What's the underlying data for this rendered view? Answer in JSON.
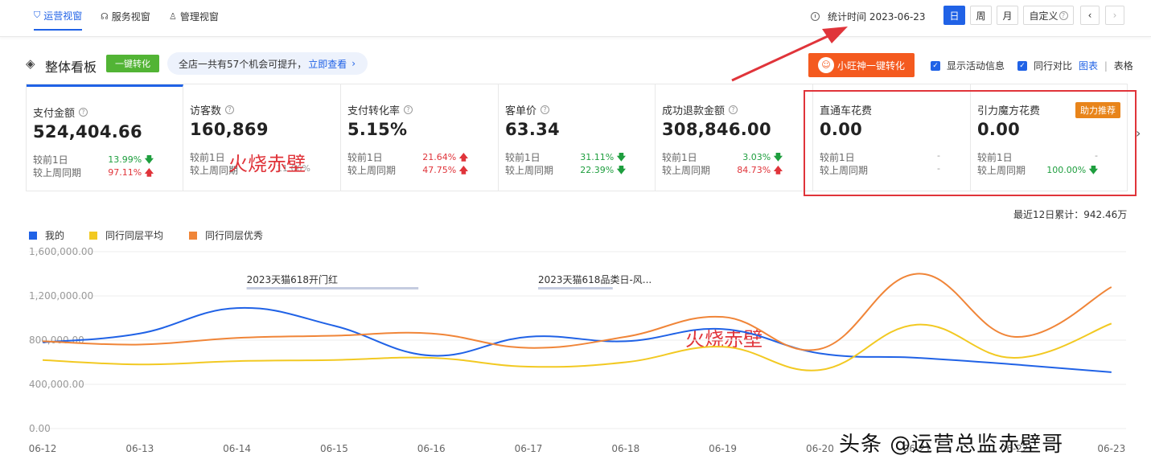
{
  "nav": {
    "tabs": [
      {
        "label": "运营视窗",
        "icon": "shield-icon",
        "active": true
      },
      {
        "label": "服务视窗",
        "icon": "headset-icon",
        "active": false
      },
      {
        "label": "管理视窗",
        "icon": "medal-icon",
        "active": false
      }
    ],
    "stat_time_label": "统计时间 2023-06-23",
    "periods": [
      "日",
      "周",
      "月"
    ],
    "custom_label": "自定义",
    "prev_icon": "chevron-left-icon",
    "next_icon": "chevron-right-icon"
  },
  "board": {
    "title": "整体看板",
    "convert_btn": "一键转化",
    "banner_text": "全店一共有57个机会可提升，",
    "banner_link": "立即查看",
    "xw_btn": "小旺神一键转化",
    "show_activity": "显示活动信息",
    "peer_compare": "同行对比",
    "view_chart": "图表",
    "view_sep": "|",
    "view_table": "表格"
  },
  "cards": [
    {
      "label": "支付金额",
      "value": "524,404.66",
      "d1_label": "较前1日",
      "d1": "13.99%",
      "d1_dir": "down",
      "w_label": "较上周同期",
      "w": "97.11%",
      "w_dir": "up",
      "help": true
    },
    {
      "label": "访客数",
      "value": "160,869",
      "d1_label": "较前1日",
      "d1": "",
      "d1_dir": "",
      "w_label": "较上周同期",
      "w": "11.06%",
      "w_dir": "",
      "help": true
    },
    {
      "label": "支付转化率",
      "value": "5.15%",
      "d1_label": "较前1日",
      "d1": "21.64%",
      "d1_dir": "up",
      "w_label": "较上周同期",
      "w": "47.75%",
      "w_dir": "up",
      "help": true
    },
    {
      "label": "客单价",
      "value": "63.34",
      "d1_label": "较前1日",
      "d1": "31.11%",
      "d1_dir": "down",
      "w_label": "较上周同期",
      "w": "22.39%",
      "w_dir": "down",
      "help": true
    },
    {
      "label": "成功退款金额",
      "value": "308,846.00",
      "d1_label": "较前1日",
      "d1": "3.03%",
      "d1_dir": "down",
      "w_label": "较上周同期",
      "w": "84.73%",
      "w_dir": "up",
      "help": true
    },
    {
      "label": "直通车花费",
      "value": "0.00",
      "d1_label": "较前1日",
      "d1": "-",
      "d1_dir": "none",
      "w_label": "较上周同期",
      "w": "-",
      "w_dir": "none",
      "help": false
    },
    {
      "label": "引力魔方花费",
      "value": "0.00",
      "d1_label": "较前1日",
      "d1": "-",
      "d1_dir": "none",
      "w_label": "较上周同期",
      "w": "100.00%",
      "w_dir": "down",
      "help": false,
      "badge": "助力推荐"
    }
  ],
  "overlay_text": "火烧赤壁",
  "cum_total": "最近12日累计：942.46万",
  "footer_watermark": "头条 @运营总监赤壁哥",
  "colors": {
    "mine": "#2062e6",
    "avg": "#f2c922",
    "top": "#f08538",
    "accent": "#2062e6"
  },
  "chart_data": {
    "type": "line",
    "x": [
      "06-12",
      "06-13",
      "06-14",
      "06-15",
      "06-16",
      "06-17",
      "06-18",
      "06-19",
      "06-20",
      "06-21",
      "06-22",
      "06-23"
    ],
    "yticks": [
      "1,600,000.00",
      "1,200,000.00",
      "800,000.00",
      "400,000.00",
      "0.00"
    ],
    "ylim": [
      0,
      1600000
    ],
    "grid": true,
    "series": [
      {
        "name": "我的",
        "values": [
          780000,
          860000,
          1090000,
          930000,
          660000,
          830000,
          790000,
          900000,
          680000,
          640000,
          580000,
          510000
        ]
      },
      {
        "name": "同行同层平均",
        "values": [
          620000,
          580000,
          610000,
          620000,
          640000,
          560000,
          600000,
          740000,
          530000,
          940000,
          640000,
          950000
        ]
      },
      {
        "name": "同行同层优秀",
        "values": [
          790000,
          760000,
          820000,
          840000,
          860000,
          730000,
          830000,
          1010000,
          720000,
          1400000,
          830000,
          1280000
        ]
      }
    ],
    "annotations": [
      {
        "text": "2023天猫618开门红",
        "from": "06-14",
        "to": "06-16"
      },
      {
        "text": "2023天猫618品类日-风...",
        "from": "06-17",
        "to": "06-18"
      }
    ]
  }
}
